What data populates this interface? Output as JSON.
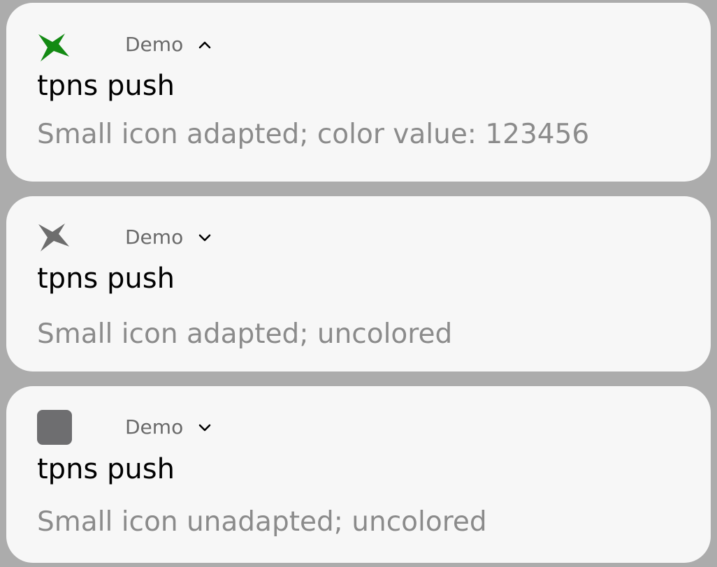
{
  "notifications": [
    {
      "app_name": "Demo",
      "expanded": true,
      "icon": "bird-icon",
      "icon_color": "#138a13",
      "title": "tpns push",
      "body": "Small icon adapted; color value: 123456"
    },
    {
      "app_name": "Demo",
      "expanded": false,
      "icon": "bird-icon",
      "icon_color": "#6d6d6d",
      "title": "tpns push",
      "body": "Small icon adapted; uncolored"
    },
    {
      "app_name": "Demo",
      "expanded": false,
      "icon": "square-icon",
      "icon_color": "#6e6e70",
      "title": "tpns push",
      "body": "Small icon unadapted; uncolored"
    }
  ],
  "colors": {
    "background": "#acacac",
    "card": "#f7f7f7",
    "app_name": "#6a6a6a",
    "title": "#000000",
    "body": "#8b8b8b"
  }
}
